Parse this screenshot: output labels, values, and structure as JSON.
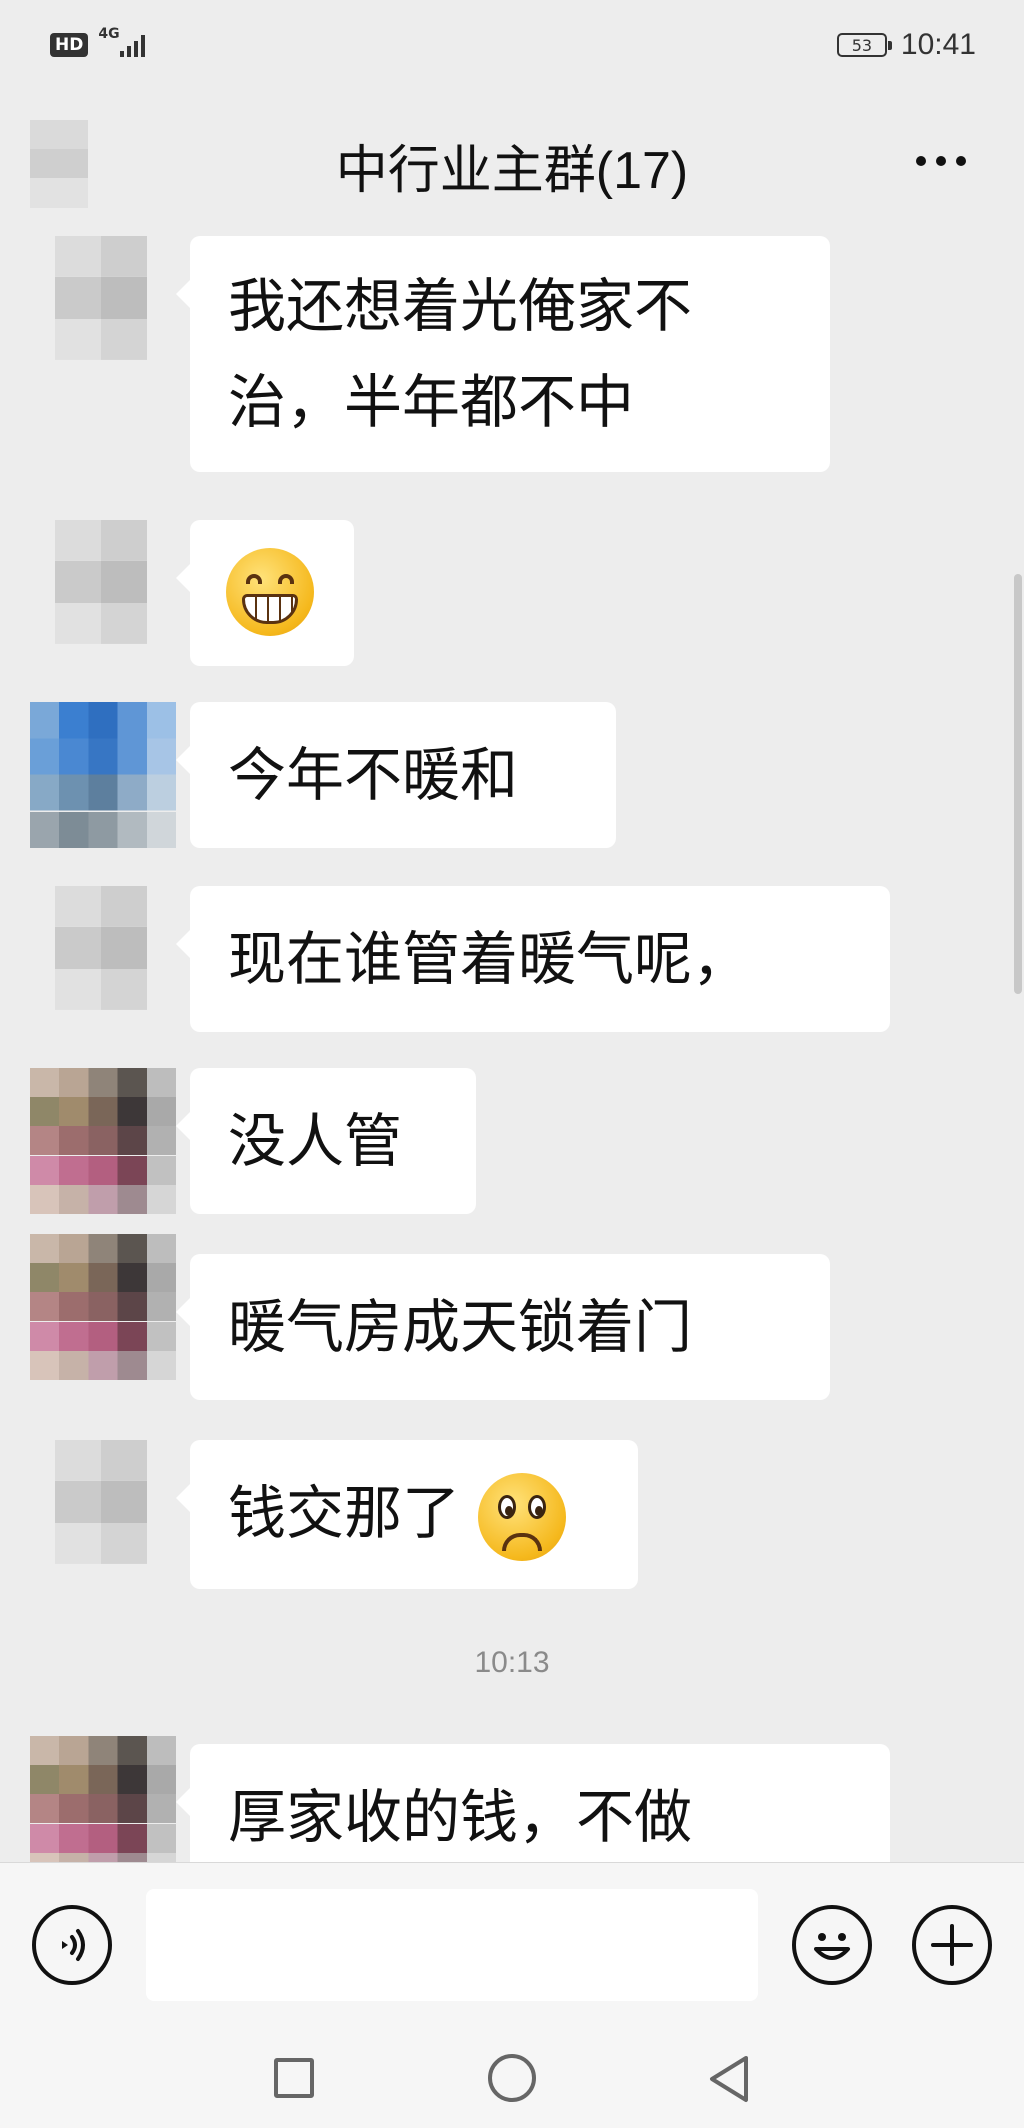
{
  "status_bar": {
    "hd": "HD",
    "network": "4G",
    "battery": "53",
    "time": "10:41"
  },
  "header": {
    "title": "中行业主群(17)",
    "more_icon": "more-icon"
  },
  "messages": [
    {
      "avatar": "gray",
      "line1": "我还想着光俺家不",
      "line2": "治，半年都不中"
    },
    {
      "avatar": "gray",
      "emoji": "grinning-face-emoji"
    },
    {
      "avatar": "blue",
      "text": "今年不暖和"
    },
    {
      "avatar": "gray",
      "text": "现在谁管着暖气呢，"
    },
    {
      "avatar": "mixed",
      "text": "没人管"
    },
    {
      "avatar": "mixed",
      "text": "暖气房成天锁着门"
    },
    {
      "avatar": "gray",
      "text": "钱交那了",
      "emoji": "sad-face-emoji"
    },
    {
      "avatar": "mixed",
      "text": "厚家收的钱，不做"
    }
  ],
  "timestamp": "10:13",
  "input_bar": {
    "voice_icon": "voice-icon",
    "input_value": "",
    "emoji_icon": "emoji-icon",
    "plus_icon": "plus-icon"
  },
  "nav_bar": {
    "recent_icon": "recent-apps-icon",
    "home_icon": "home-icon",
    "back_icon": "back-icon"
  }
}
